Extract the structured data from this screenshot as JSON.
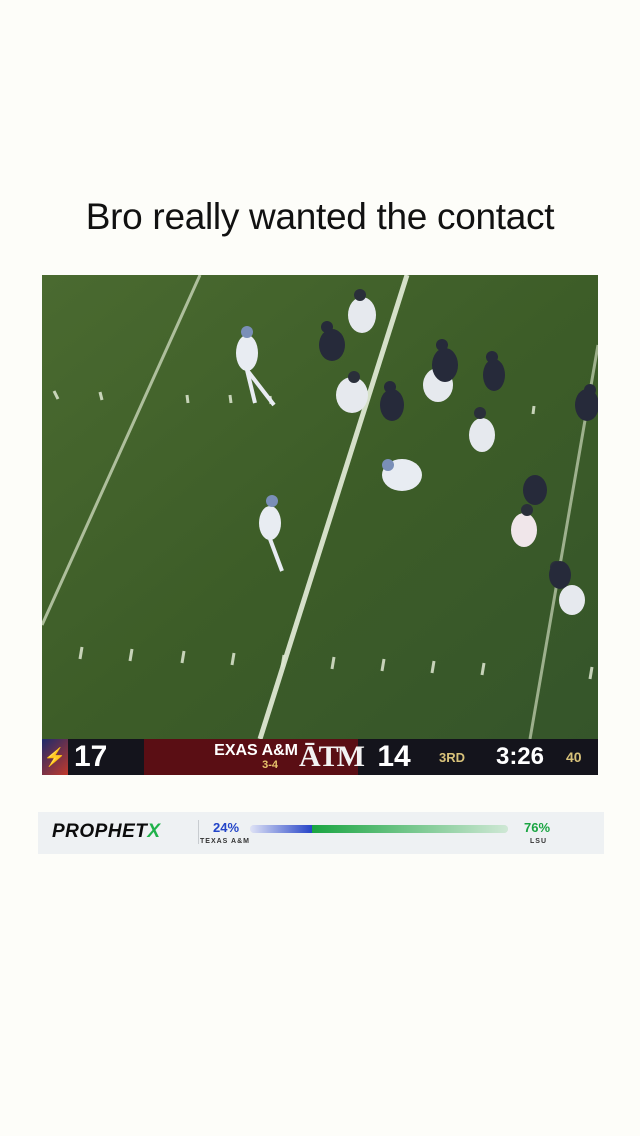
{
  "post": {
    "caption": "Bro really wanted the contact"
  },
  "scorebug": {
    "away_score": "17",
    "home_name": "EXAS A&M",
    "home_record": "3-4",
    "home_logo_text": "ĀTM",
    "home_score": "14",
    "quarter": "3RD",
    "clock": "3:26",
    "play_info": "40"
  },
  "sponsor": {
    "logo_text": "PROPHET",
    "logo_x": "X",
    "left_pct": "24%",
    "left_pct_value": 24,
    "left_team": "TEXAS A&M",
    "right_pct": "76%",
    "right_pct_value": 76,
    "right_team": "LSU"
  },
  "colors": {
    "field": "#3a5a2a",
    "home_team": "#5a0e14",
    "left_accent": "#2745c8",
    "right_accent": "#1aa542"
  }
}
